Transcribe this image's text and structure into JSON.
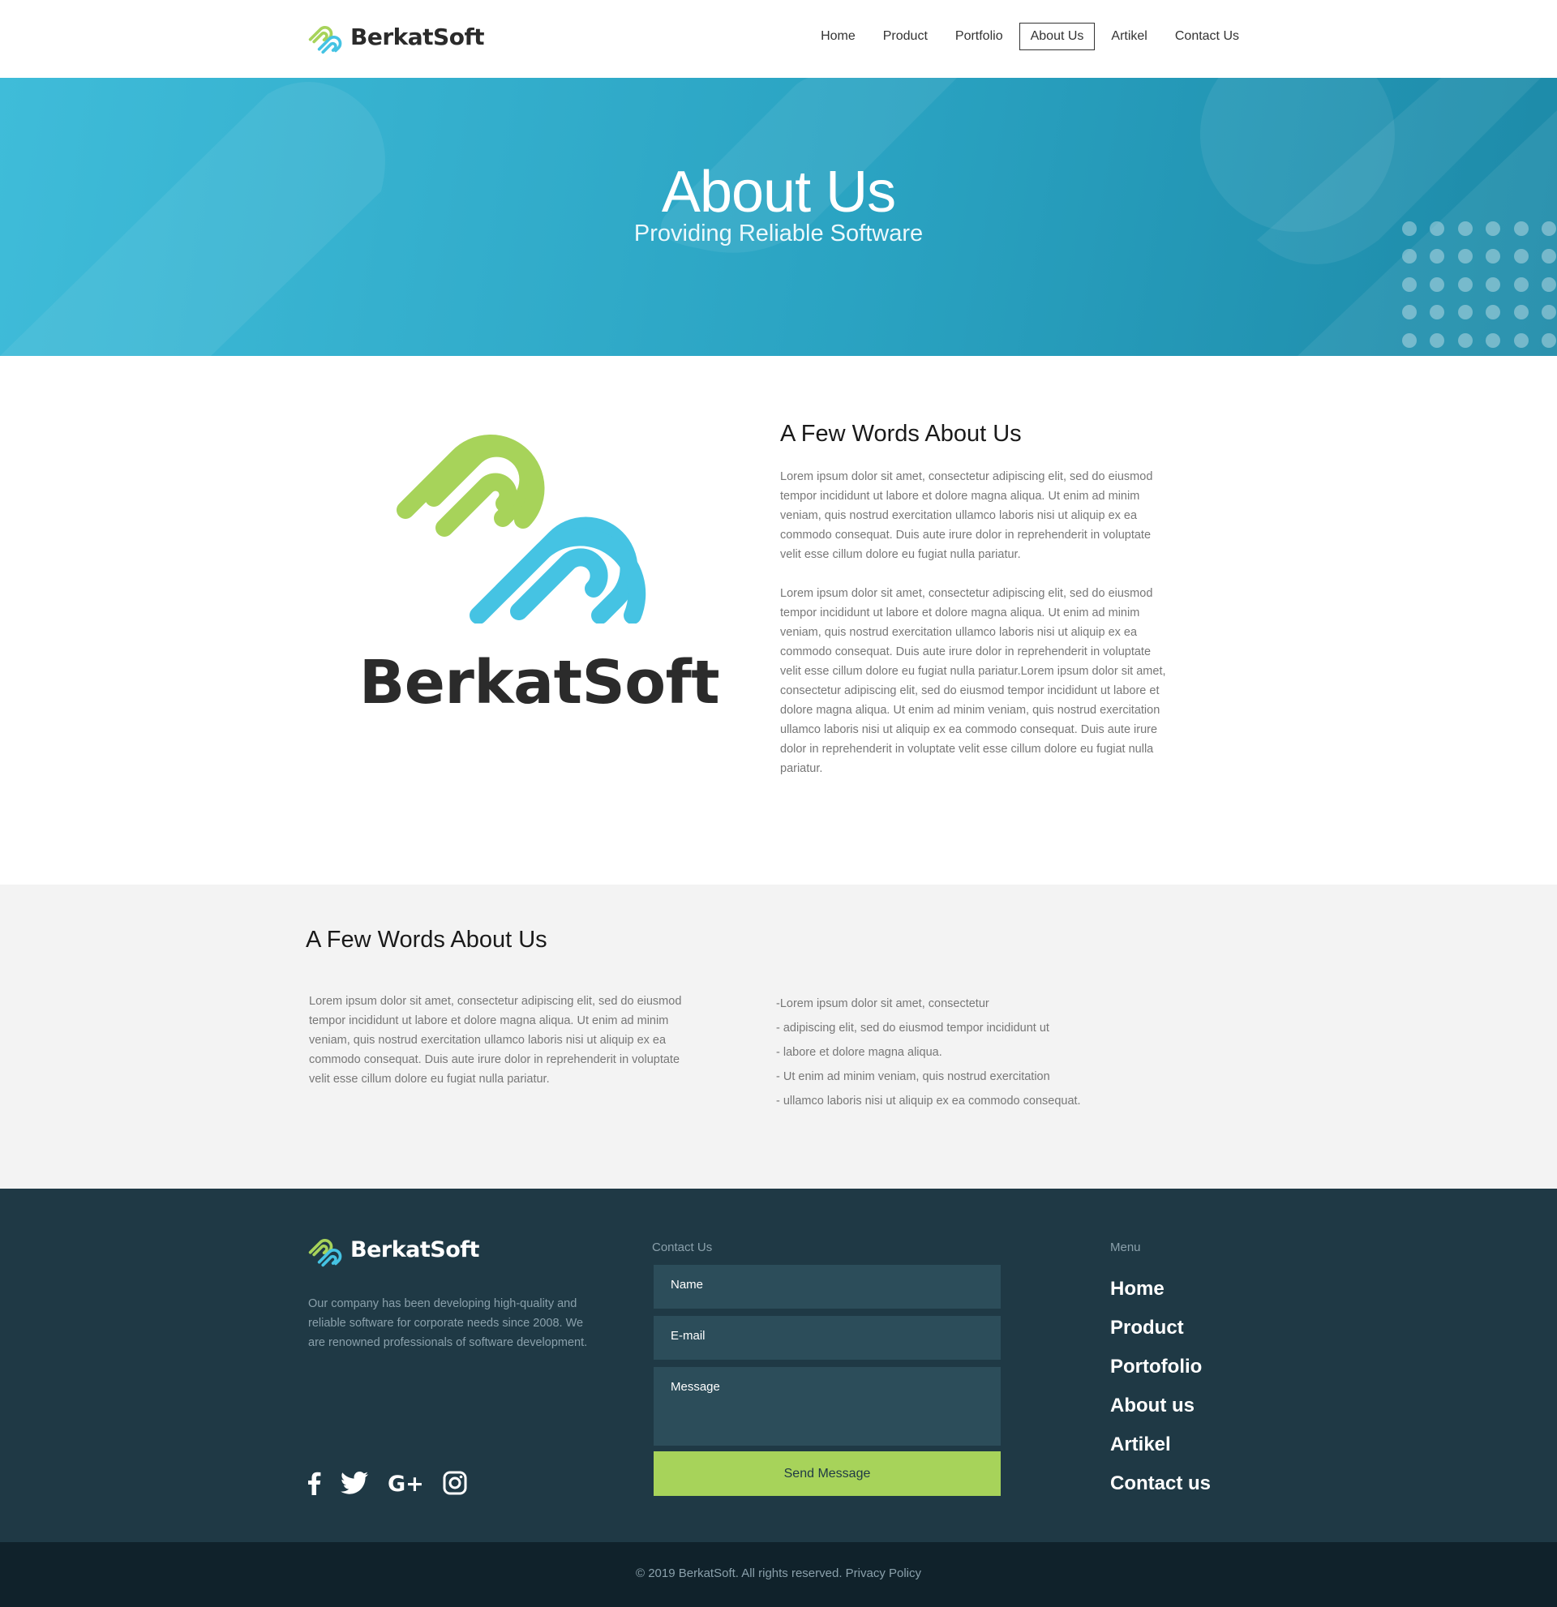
{
  "brand": {
    "name": "BerkatSoft",
    "colors": {
      "green": "#a7d35a",
      "blue": "#45c3e3",
      "dark": "#2b2b2b",
      "accent": "#2aa3c2"
    }
  },
  "nav": {
    "items": [
      {
        "label": "Home"
      },
      {
        "label": "Product"
      },
      {
        "label": "Portfolio"
      },
      {
        "label": "About Us",
        "active": true
      },
      {
        "label": "Artikel"
      },
      {
        "label": "Contact Us"
      }
    ]
  },
  "hero": {
    "title": "About Us",
    "subtitle": "Providing Reliable Software"
  },
  "about": {
    "heading": "A Few Words About Us",
    "paragraph1": "Lorem ipsum dolor sit amet, consectetur adipiscing elit, sed do eiusmod tempor incididunt ut labore et dolore magna aliqua. Ut enim ad minim veniam, quis nostrud exercitation ullamco laboris nisi ut aliquip ex ea commodo consequat. Duis aute irure dolor in reprehenderit in voluptate velit esse cillum dolore eu fugiat nulla pariatur.",
    "paragraph2": "Lorem ipsum dolor sit amet, consectetur adipiscing elit, sed do eiusmod tempor incididunt ut labore et dolore magna aliqua. Ut enim ad minim veniam, quis nostrud exercitation ullamco laboris nisi ut aliquip ex ea commodo consequat. Duis aute irure dolor in reprehenderit in voluptate velit esse cillum dolore eu fugiat nulla pariatur.Lorem ipsum dolor sit amet, consectetur adipiscing elit, sed do eiusmod tempor incididunt ut labore et dolore magna aliqua. Ut enim ad minim veniam, quis nostrud exercitation ullamco laboris nisi ut aliquip ex ea commodo consequat. Duis aute irure dolor in reprehenderit in voluptate velit esse cillum dolore eu fugiat nulla pariatur."
  },
  "second": {
    "heading": "A Few Words About Us",
    "paragraph": "Lorem ipsum dolor sit amet, consectetur adipiscing elit, sed do eiusmod tempor incididunt ut labore et dolore magna aliqua. Ut enim ad minim veniam, quis nostrud exercitation ullamco laboris nisi ut aliquip ex ea commodo consequat. Duis aute irure dolor in reprehenderit in voluptate velit esse cillum dolore eu fugiat nulla pariatur.",
    "bullets": [
      "-Lorem ipsum dolor sit amet, consectetur",
      "- adipiscing elit, sed do eiusmod tempor incididunt ut",
      "- labore et dolore magna aliqua.",
      "- Ut enim ad minim veniam, quis nostrud exercitation",
      "- ullamco laboris nisi ut aliquip ex ea commodo consequat."
    ]
  },
  "footer": {
    "description": "Our company has been developing high-quality and reliable software for corporate needs since 2008. We are renowned professionals of software development.",
    "social_icons": [
      "facebook-icon",
      "twitter-icon",
      "google-plus-icon",
      "instagram-icon"
    ],
    "contact": {
      "heading": "Contact Us",
      "name_placeholder": "Name",
      "email_placeholder": "E-mail",
      "message_placeholder": "Message",
      "send_label": "Send Message"
    },
    "menu": {
      "heading": "Menu",
      "items": [
        "Home",
        "Product",
        "Portofolio",
        "About us",
        "Artikel",
        "Contact us"
      ]
    },
    "copyright": "© 2019 BerkatSoft. All rights reserved. Privacy Policy"
  }
}
